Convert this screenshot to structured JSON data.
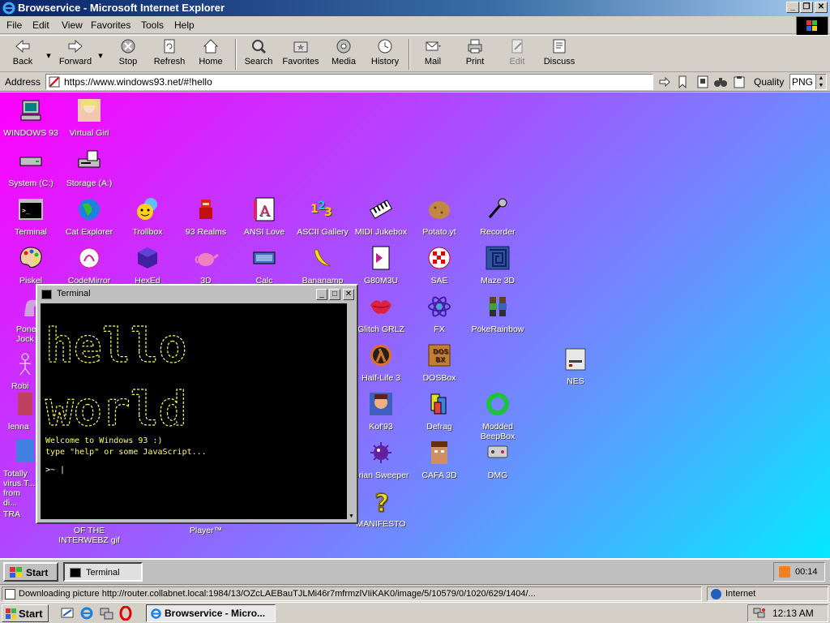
{
  "window": {
    "title": "Browservice - Microsoft Internet Explorer",
    "minimize": "_",
    "restore": "❐",
    "close": "✕"
  },
  "menu": [
    "File",
    "Edit",
    "View",
    "Favorites",
    "Tools",
    "Help"
  ],
  "toolbar": {
    "back": "Back",
    "forward": "Forward",
    "stop": "Stop",
    "refresh": "Refresh",
    "home": "Home",
    "search": "Search",
    "favorites": "Favorites",
    "media": "Media",
    "history": "History",
    "mail": "Mail",
    "print": "Print",
    "edit": "Edit",
    "discuss": "Discuss"
  },
  "address": {
    "label": "Address",
    "url": "https://www.windows93.net/#!hello",
    "quality_label": "Quality",
    "quality_value": "PNG"
  },
  "desktop": {
    "icons": [
      {
        "label": "WINDOWS 93"
      },
      {
        "label": "Virtual Girl"
      },
      {
        "label": "System (C:)"
      },
      {
        "label": "Storage (A:)"
      },
      {
        "label": "Terminal"
      },
      {
        "label": "Cat Explorer"
      },
      {
        "label": "Trollbox"
      },
      {
        "label": "93 Realms"
      },
      {
        "label": "ANSI Love"
      },
      {
        "label": "ASCII Gallery"
      },
      {
        "label": "MIDI Jukebox"
      },
      {
        "label": "Potato.yt"
      },
      {
        "label": "Recorder"
      },
      {
        "label": "Piskel"
      },
      {
        "label": "CodeMirror"
      },
      {
        "label": "HexEd"
      },
      {
        "label": "3D"
      },
      {
        "label": "Calc"
      },
      {
        "label": "Bananamp"
      },
      {
        "label": "G80M3U"
      },
      {
        "label": "SAE"
      },
      {
        "label": "Maze 3D"
      },
      {
        "label": "Glitch GRLZ"
      },
      {
        "label": "FX"
      },
      {
        "label": "PokeRainbow"
      },
      {
        "label": "Half-Life 3"
      },
      {
        "label": "DOSBox"
      },
      {
        "label": "NES"
      },
      {
        "label": "Kof'93"
      },
      {
        "label": "Defrag"
      },
      {
        "label": "Modded BeepBox"
      },
      {
        "label": "Brian Sweeper"
      },
      {
        "label": "CAFA 3D"
      },
      {
        "label": "DMG"
      },
      {
        "label": "MANIFESTO"
      }
    ],
    "partial_labels": [
      "Pone Jock",
      "Robi",
      "lenna",
      "Totally virus.T... from di...",
      "TRA",
      "OF THE INTERWEBZ gif",
      "Player™"
    ]
  },
  "terminal": {
    "title": "Terminal",
    "art_line1": "hello",
    "art_line2": "world",
    "welcome": "Welcome to Windows 93 :)",
    "hint": "type \"help\" or some JavaScript...",
    "prompt": ">~ |"
  },
  "inner_taskbar": {
    "start": "Start",
    "task": "Terminal",
    "clock": "00:14"
  },
  "status": {
    "text": "Downloading picture http://router.collabnet.local:1984/13/OZcLAEBauTJLMi46r7mfrmzlVIiKAK0/image/5/10579/0/1020/629/1404/...",
    "zone": "Internet"
  },
  "host_taskbar": {
    "start": "Start",
    "task": "Browservice - Micro...",
    "clock": "12:13 AM"
  }
}
